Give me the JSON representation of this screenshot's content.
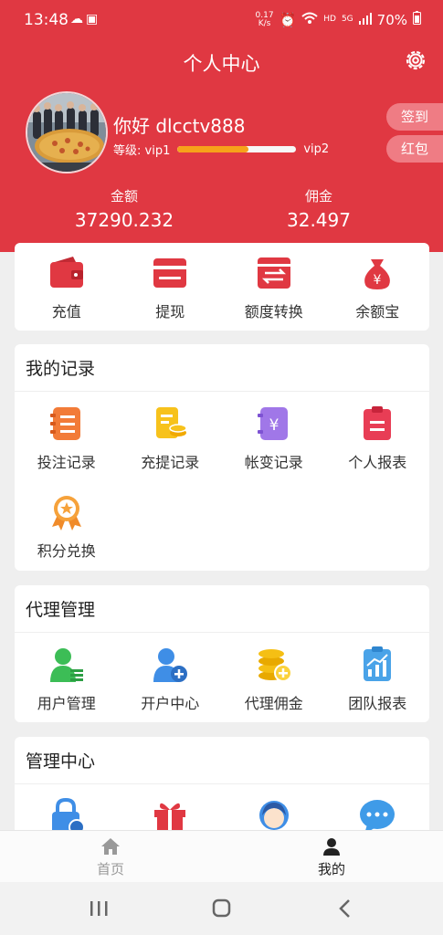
{
  "status": {
    "time": "13:48",
    "speed_value": "0.17",
    "speed_unit": "K/s",
    "network": "HD",
    "signal": "5G",
    "battery": "70%"
  },
  "header": {
    "title": "个人中心",
    "greeting": "你好 dlcctv888",
    "level_label": "等级: vip1",
    "next_level": "vip2",
    "level_progress": 0.6,
    "sign_in": "签到",
    "red_packet": "红包",
    "balance_label": "金额",
    "balance_value": "37290.232",
    "commission_label": "佣金",
    "commission_value": "32.497"
  },
  "quick": [
    {
      "label": "充值",
      "icon": "wallet-icon"
    },
    {
      "label": "提现",
      "icon": "card-icon"
    },
    {
      "label": "额度转换",
      "icon": "transfer-icon"
    },
    {
      "label": "余额宝",
      "icon": "money-bag-icon"
    }
  ],
  "records": {
    "title": "我的记录",
    "items": [
      {
        "label": "投注记录",
        "icon": "bet-record-icon"
      },
      {
        "label": "充提记录",
        "icon": "deposit-record-icon"
      },
      {
        "label": "帐变记录",
        "icon": "account-change-icon"
      },
      {
        "label": "个人报表",
        "icon": "report-icon"
      },
      {
        "label": "积分兑换",
        "icon": "medal-icon"
      }
    ]
  },
  "agent": {
    "title": "代理管理",
    "items": [
      {
        "label": "用户管理",
        "icon": "user-manage-icon"
      },
      {
        "label": "开户中心",
        "icon": "add-user-icon"
      },
      {
        "label": "代理佣金",
        "icon": "coins-icon"
      },
      {
        "label": "团队报表",
        "icon": "team-report-icon"
      }
    ]
  },
  "manage": {
    "title": "管理中心",
    "items": [
      {
        "icon": "lock-settings-icon"
      },
      {
        "icon": "gift-icon"
      },
      {
        "icon": "support-icon"
      },
      {
        "icon": "message-icon"
      }
    ]
  },
  "tabs": {
    "home": "首页",
    "mine": "我的"
  },
  "colors": {
    "brand": "#e03842",
    "accent": "#f7a11a"
  }
}
